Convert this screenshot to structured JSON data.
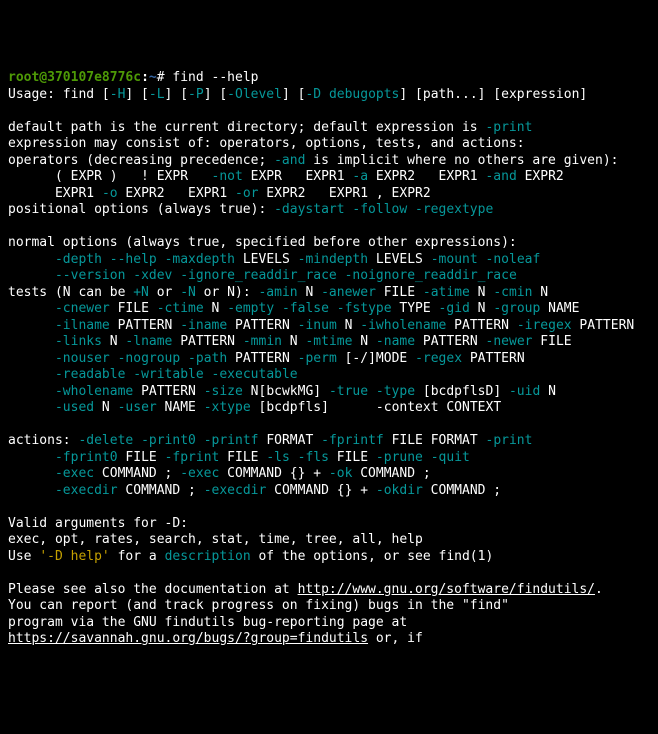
{
  "prompt": {
    "userhost": "root@370107e8776c",
    "path": "~",
    "symbol": "#",
    "command": "find --help"
  },
  "usage": {
    "prefix": "Usage: find ",
    "flags": [
      "-H",
      "-L",
      "-P",
      "-Olevel",
      "-D"
    ],
    "brackets": [
      "[",
      "] [",
      "]"
    ],
    "debugopts": "debugopts",
    "tail": "] [path...] [expression]"
  },
  "para1": {
    "l1a": "default path is the current directory; default expression is ",
    "l1b": "-print",
    "l2": "expression may consist of: operators, options, tests, and actions:",
    "l3a": "operators (decreasing precedence; ",
    "l3b": "-and",
    "l3c": " is implicit where no others are given):"
  },
  "ops": {
    "line1_a": "      ( EXPR )   ! EXPR   ",
    "line1_not": "-not",
    "line1_b": " EXPR   EXPR1 ",
    "line1_adash": "-a",
    "line1_c": " EXPR2   EXPR1 ",
    "line1_and": "-and",
    "line1_d": " EXPR2",
    "line2_a": "      EXPR1 ",
    "line2_o": "-o",
    "line2_b": " EXPR2   EXPR1 ",
    "line2_or": "-or",
    "line2_c": " EXPR2   EXPR1 , EXPR2"
  },
  "posopts": {
    "prefix": "positional options (always true): ",
    "items": [
      "-daystart",
      "-follow",
      "-regextype"
    ]
  },
  "normopts": {
    "header": "normal options (always true, specified before other expressions):",
    "indent": "      ",
    "row1": [
      "-depth",
      "--help",
      "-maxdepth",
      " LEVELS ",
      "-mindepth",
      " LEVELS ",
      "-mount",
      "-noleaf"
    ],
    "row2": [
      "--version",
      "-xdev",
      "-ignore_readdir_race",
      "-noignore_readdir_race"
    ]
  },
  "tests": {
    "head_a": "tests (N can be ",
    "plusN": "+N",
    "head_b": " or ",
    "minusN": "-N",
    "head_c": " or N): ",
    "t1": [
      "-amin",
      " N ",
      "-anewer",
      " FILE ",
      "-atime",
      " N ",
      "-cmin",
      " N"
    ],
    "indent": "      ",
    "t2": [
      "-cnewer",
      " FILE ",
      "-ctime",
      " N ",
      "-empty",
      " ",
      "-false",
      " ",
      "-fstype",
      " TYPE ",
      "-gid",
      " N ",
      "-group",
      " NAME"
    ],
    "t3": [
      "-ilname",
      " PATTERN ",
      "-iname",
      " PATTERN ",
      "-inum",
      " N ",
      "-iwholename",
      " PATTERN ",
      "-iregex",
      " PATTERN"
    ],
    "t4": [
      "-links",
      " N ",
      "-lname",
      " PATTERN ",
      "-mmin",
      " N ",
      "-mtime",
      " N ",
      "-name",
      " PATTERN ",
      "-newer",
      " FILE"
    ],
    "t5": [
      "-nouser",
      " ",
      "-nogroup",
      " ",
      "-path",
      " PATTERN ",
      "-perm",
      " [-/]MODE ",
      "-regex",
      " PATTERN"
    ],
    "t6": [
      "-readable",
      " ",
      "-writable",
      " ",
      "-executable"
    ],
    "t7": [
      "-wholename",
      " PATTERN ",
      "-size",
      " N[bcwkMG] ",
      "-true",
      " ",
      "-type",
      " [bcdpflsD] ",
      "-uid",
      " N"
    ],
    "t8": [
      "-used",
      " N ",
      "-user",
      " NAME ",
      "-xtype",
      " [bcdpfls]"
    ],
    "t8tail": "      -context CONTEXT"
  },
  "actions": {
    "head": "actions: ",
    "a1": [
      "-delete",
      " ",
      "-print0",
      " ",
      "-printf",
      " FORMAT ",
      "-fprintf",
      " FILE FORMAT ",
      "-print"
    ],
    "indent": "      ",
    "a2": [
      "-fprint0",
      " FILE ",
      "-fprint",
      " FILE ",
      "-ls",
      " ",
      "-fls",
      " FILE ",
      "-prune",
      " ",
      "-quit"
    ],
    "a3": [
      "-exec",
      " COMMAND ; ",
      "-exec",
      " COMMAND {} + ",
      "-ok",
      " COMMAND ;"
    ],
    "a4": [
      "-execdir",
      " COMMAND ; ",
      "-execdir",
      " COMMAND {} + ",
      "-okdir",
      " COMMAND ;"
    ]
  },
  "validD": {
    "l1": "Valid arguments for -D:",
    "l2": "exec, opt, rates, search, stat, time, tree, all, help",
    "l3a": "Use ",
    "l3b": "'-D help'",
    "l3c": " for a ",
    "l3d": "description",
    "l3e": " of the options, or see find(1)"
  },
  "footer": {
    "l1a": "Please see also the documentation at ",
    "l1b": "http://www.gnu.org/software/findutils/",
    "l2": "You can report (and track progress on fixing) bugs in the \"find\"",
    "l3": "program via the GNU findutils bug-reporting page at",
    "l4a": "https://savannah.gnu.org/bugs/?group=findutils",
    "l4b": " or, if"
  }
}
